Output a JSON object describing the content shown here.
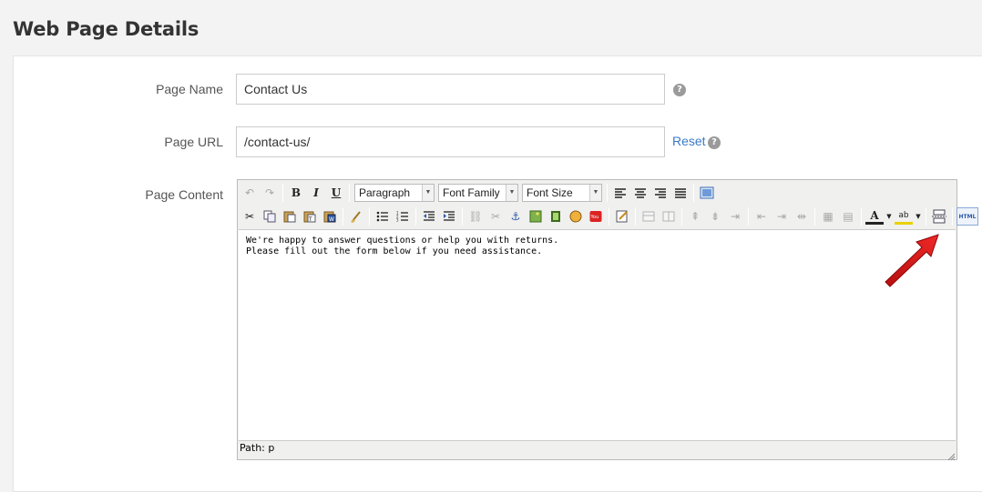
{
  "page": {
    "title": "Web Page Details"
  },
  "form": {
    "page_name": {
      "label": "Page Name",
      "value": "Contact Us",
      "help": "?"
    },
    "page_url": {
      "label": "Page URL",
      "value": "/contact-us/",
      "reset": "Reset",
      "help": "?"
    },
    "page_content": {
      "label": "Page Content"
    }
  },
  "editor": {
    "toolbar1": {
      "undo": "↶",
      "redo": "↷",
      "bold": "B",
      "italic": "I",
      "underline": "U",
      "format_select": "Paragraph",
      "font_family_select": "Font Family",
      "font_size_select": "Font Size"
    },
    "content_lines": [
      "We're happy to answer questions or help you with returns.",
      "Please fill out the form below if you need assistance."
    ],
    "path": "Path: p",
    "html_button": "HTML"
  },
  "colors": {
    "link": "#3a7bc8",
    "arrow": "#e01b1b"
  }
}
